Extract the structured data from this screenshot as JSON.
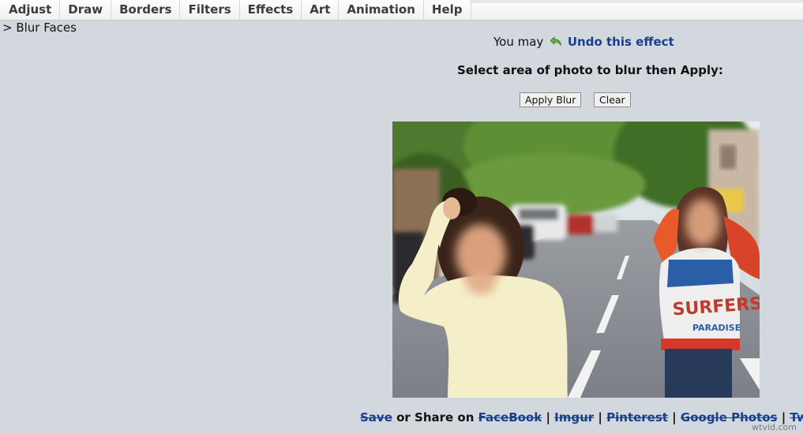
{
  "menu": {
    "items": [
      {
        "label": "Adjust"
      },
      {
        "label": "Draw"
      },
      {
        "label": "Borders"
      },
      {
        "label": "Filters"
      },
      {
        "label": "Effects"
      },
      {
        "label": "Art"
      },
      {
        "label": "Animation"
      },
      {
        "label": "Help"
      }
    ]
  },
  "breadcrumb": {
    "text": "> Blur Faces"
  },
  "undo": {
    "prefix": "You may",
    "icon": "undo-arrow-icon",
    "link_label": "Undo this effect"
  },
  "instruction": "Select area of photo to blur then Apply:",
  "buttons": {
    "apply_label": "Apply Blur",
    "clear_label": "Clear"
  },
  "photo": {
    "alt": "two-girls-street-photo"
  },
  "share": {
    "save_label": "Save",
    "or_share_text": " or Share on ",
    "links": [
      "FaceBook",
      "Imgur",
      "Pinterest",
      "Google Photos",
      "Twitter"
    ],
    "separator": " | "
  },
  "watermark": "wtvid.com",
  "colors": {
    "background": "#d3d8df",
    "link": "#1a3f8a",
    "undo_icon": "#4caf3a"
  }
}
